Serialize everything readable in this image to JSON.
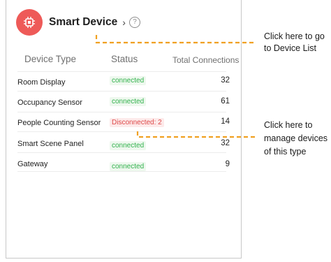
{
  "header": {
    "title": "Smart Device",
    "chevron": "›",
    "help_glyph": "?",
    "icon": "chip-icon",
    "icon_color": "#ee5a58"
  },
  "table": {
    "columns": [
      "Device Type",
      "Status",
      "Total Connections"
    ],
    "rows": [
      {
        "type": "Room Display",
        "status": "connected",
        "status_kind": "ok",
        "connections": "32"
      },
      {
        "type": "Occupancy Sensor",
        "status": "connected",
        "status_kind": "ok",
        "connections": "61"
      },
      {
        "type": "People Counting Sensor",
        "status": "Disconnected: 2",
        "status_kind": "bad",
        "connections": "14"
      },
      {
        "type": "Smart Scene Panel",
        "status": "connected",
        "status_kind": "ok",
        "connections": "32"
      },
      {
        "type": "Gateway",
        "status": "connected",
        "status_kind": "ok",
        "connections": "9"
      }
    ]
  },
  "annotations": {
    "device_list_note": [
      "Click here to go",
      "to Device List"
    ],
    "manage_note": [
      "Click here to",
      "manage devices",
      "of this type"
    ],
    "line_color": "#f0a020"
  },
  "colors": {
    "connected": "#33b24e",
    "disconnected": "#de4a4a"
  }
}
